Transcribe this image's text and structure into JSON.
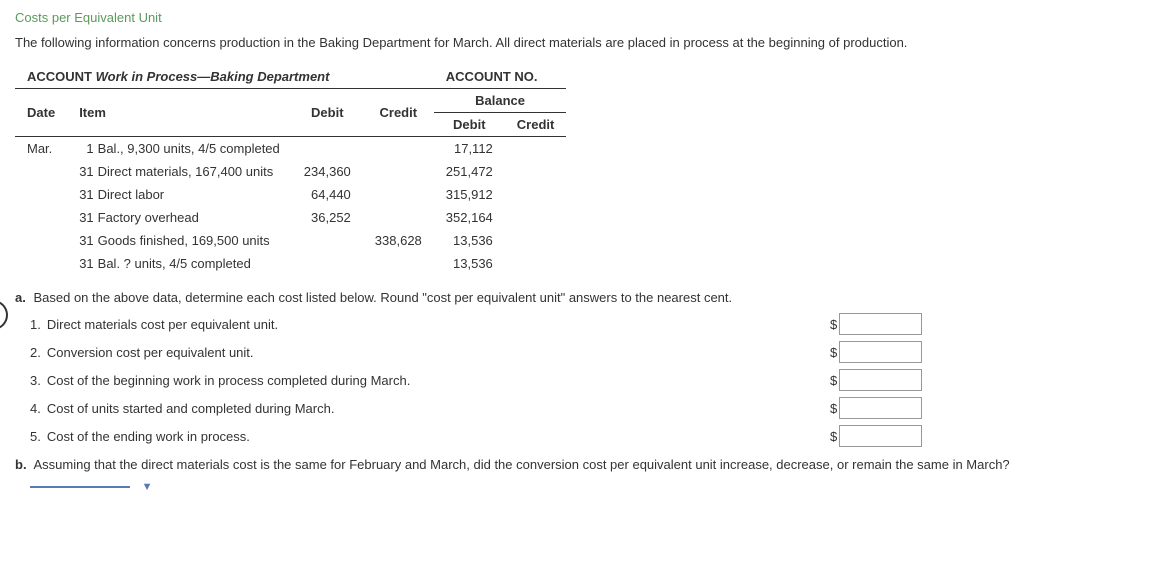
{
  "title": "Costs per Equivalent Unit",
  "intro": "The following information concerns production in the Baking Department for March. All direct materials are placed in process at the beginning of production.",
  "ledger": {
    "account_label": "ACCOUNT",
    "account_name": "Work in Process—Baking Department",
    "account_no_label": "ACCOUNT NO.",
    "headers": {
      "date": "Date",
      "item": "Item",
      "debit": "Debit",
      "credit": "Credit",
      "balance": "Balance",
      "balance_debit": "Debit",
      "balance_credit": "Credit"
    },
    "rows": [
      {
        "month": "Mar.",
        "day": "1",
        "item": "Bal., 9,300 units, 4/5 completed",
        "debit": "",
        "credit": "",
        "bdebit": "17,112",
        "bcredit": ""
      },
      {
        "month": "",
        "day": "31",
        "item": "Direct materials, 167,400 units",
        "debit": "234,360",
        "credit": "",
        "bdebit": "251,472",
        "bcredit": ""
      },
      {
        "month": "",
        "day": "31",
        "item": "Direct labor",
        "debit": "64,440",
        "credit": "",
        "bdebit": "315,912",
        "bcredit": ""
      },
      {
        "month": "",
        "day": "31",
        "item": "Factory overhead",
        "debit": "36,252",
        "credit": "",
        "bdebit": "352,164",
        "bcredit": ""
      },
      {
        "month": "",
        "day": "31",
        "item": "Goods finished, 169,500 units",
        "debit": "",
        "credit": "338,628",
        "bdebit": "13,536",
        "bcredit": ""
      },
      {
        "month": "",
        "day": "31",
        "item": "Bal. ? units, 4/5 completed",
        "debit": "",
        "credit": "",
        "bdebit": "13,536",
        "bcredit": ""
      }
    ]
  },
  "question_a": {
    "bullet": "a.",
    "text": "Based on the above data, determine each cost listed below. Round \"cost per equivalent unit\" answers to the nearest cent."
  },
  "sub_questions": [
    {
      "num": "1.",
      "text": "Direct materials cost per equivalent unit."
    },
    {
      "num": "2.",
      "text": "Conversion cost per equivalent unit."
    },
    {
      "num": "3.",
      "text": "Cost of the beginning work in process completed during March."
    },
    {
      "num": "4.",
      "text": "Cost of units started and completed during March."
    },
    {
      "num": "5.",
      "text": "Cost of the ending work in process."
    }
  ],
  "currency_symbol": "$",
  "question_b": {
    "bullet": "b.",
    "text": "Assuming that the direct materials cost is the same for February and March, did the conversion cost per equivalent unit increase, decrease, or remain the same in March?"
  }
}
